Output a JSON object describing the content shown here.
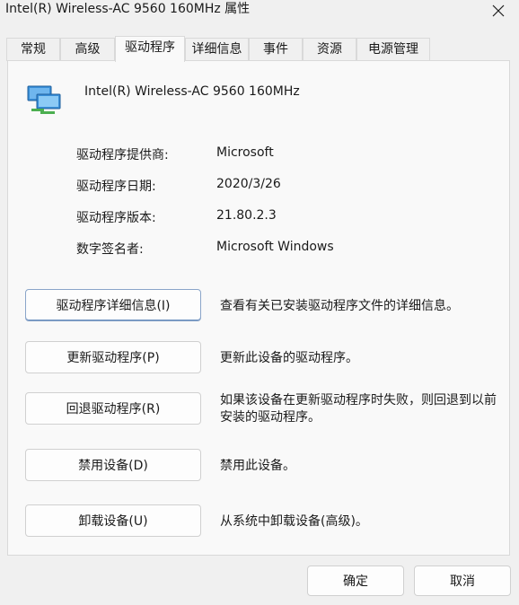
{
  "window": {
    "title": "Intel(R) Wireless-AC 9560 160MHz 属性",
    "close_icon": "close-icon"
  },
  "tabs": [
    {
      "label": "常规"
    },
    {
      "label": "高级"
    },
    {
      "label": "驱动程序",
      "active": true
    },
    {
      "label": "详细信息"
    },
    {
      "label": "事件"
    },
    {
      "label": "资源"
    },
    {
      "label": "电源管理"
    }
  ],
  "device": {
    "icon": "network-adapter-icon",
    "name": "Intel(R) Wireless-AC 9560 160MHz"
  },
  "properties": [
    {
      "label": "驱动程序提供商:",
      "value": "Microsoft"
    },
    {
      "label": "驱动程序日期:",
      "value": "2020/3/26"
    },
    {
      "label": "驱动程序版本:",
      "value": "21.80.2.3"
    },
    {
      "label": "数字签名者:",
      "value": "Microsoft Windows"
    }
  ],
  "actions": [
    {
      "button": "驱动程序详细信息(I)",
      "description": "查看有关已安装驱动程序文件的详细信息。"
    },
    {
      "button": "更新驱动程序(P)",
      "description": "更新此设备的驱动程序。"
    },
    {
      "button": "回退驱动程序(R)",
      "description": "如果该设备在更新驱动程序时失败，则回退到以前安装的驱动程序。"
    },
    {
      "button": "禁用设备(D)",
      "description": "禁用此设备。"
    },
    {
      "button": "卸载设备(U)",
      "description": "从系统中卸载设备(高级)。"
    }
  ],
  "footer": {
    "ok_label": "确定",
    "cancel_label": "取消"
  }
}
